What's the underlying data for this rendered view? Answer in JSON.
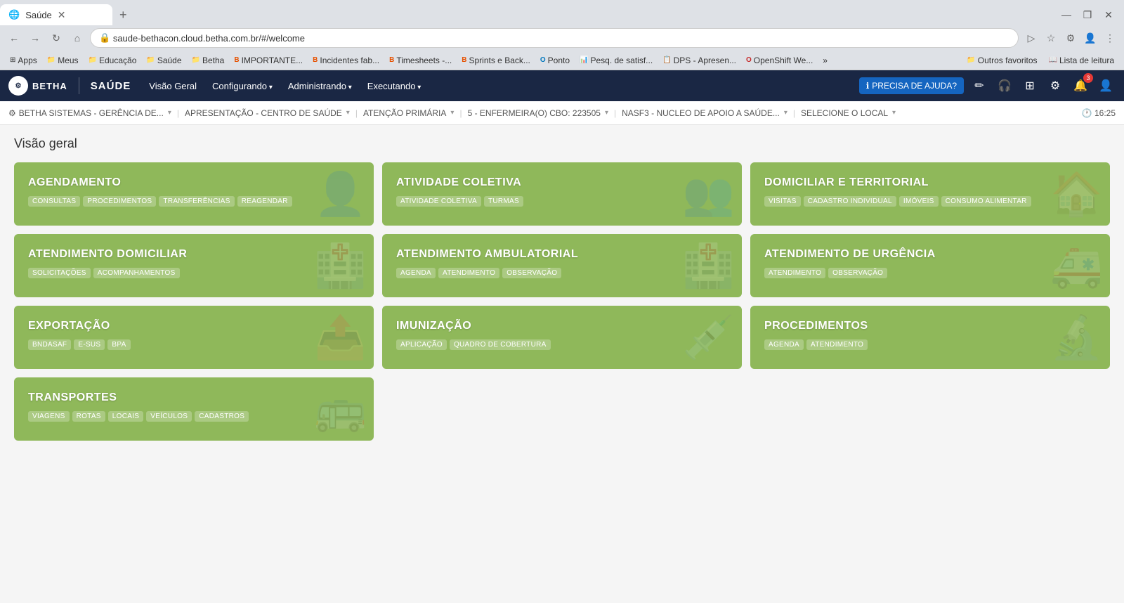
{
  "browser": {
    "tab_title": "Saúde",
    "url": "saude-bethacon.cloud.betha.com.br/#/welcome",
    "bookmarks": [
      {
        "label": "Apps",
        "icon": "⊞"
      },
      {
        "label": "Meus",
        "icon": "📁"
      },
      {
        "label": "Educação",
        "icon": "📁"
      },
      {
        "label": "Saúde",
        "icon": "📁"
      },
      {
        "label": "Betha",
        "icon": "📁"
      },
      {
        "label": "IMPORTANTE...",
        "icon": "B"
      },
      {
        "label": "Incidentes fab...",
        "icon": "B"
      },
      {
        "label": "Timesheets -...",
        "icon": "B"
      },
      {
        "label": "Sprints e Back...",
        "icon": "B"
      },
      {
        "label": "Ponto",
        "icon": "O"
      },
      {
        "label": "Pesq. de satisf...",
        "icon": "📊"
      },
      {
        "label": "DPS - Apresen...",
        "icon": "📋"
      },
      {
        "label": "OpenShift We...",
        "icon": "O"
      },
      {
        "label": "»",
        "icon": ""
      },
      {
        "label": "Outros favoritos",
        "icon": "📁"
      },
      {
        "label": "Lista de leitura",
        "icon": "📖"
      }
    ]
  },
  "header": {
    "logo_text": "BETHA",
    "system_name": "SAÚDE",
    "nav_items": [
      {
        "label": "Visão Geral",
        "dropdown": false
      },
      {
        "label": "Configurando",
        "dropdown": true
      },
      {
        "label": "Administrando",
        "dropdown": true
      },
      {
        "label": "Executando",
        "dropdown": true
      }
    ],
    "help_button": "PRECISA DE AJUDA?",
    "notification_count": "3"
  },
  "breadcrumbs": [
    {
      "label": "BETHA SISTEMAS - GERÊNCIA DE...",
      "has_chevron": true
    },
    {
      "label": "APRESENTAÇÃO - CENTRO DE SAÚDE",
      "has_chevron": true
    },
    {
      "label": "ATENÇÃO PRIMÁRIA",
      "has_chevron": true
    },
    {
      "label": "5 - ENFERMEIRA(O) CBO: 223505",
      "has_chevron": true
    },
    {
      "label": "NASF3 - NUCLEO DE APOIO A SAÚDE...",
      "has_chevron": true
    },
    {
      "label": "SELECIONE O LOCAL",
      "has_chevron": true
    }
  ],
  "time": "16:25",
  "page_title": "Visão geral",
  "cards": [
    {
      "title": "AGENDAMENTO",
      "tags": [
        "CONSULTAS",
        "PROCEDIMENTOS",
        "TRANSFERÊNCIAS",
        "REAGENDAR"
      ],
      "watermark": "👤"
    },
    {
      "title": "ATIVIDADE COLETIVA",
      "tags": [
        "ATIVIDADE COLETIVA",
        "TURMAS"
      ],
      "watermark": "👥"
    },
    {
      "title": "DOMICILIAR E TERRITORIAL",
      "tags": [
        "VISITAS",
        "CADASTRO INDIVIDUAL",
        "IMÓVEIS",
        "CONSUMO ALIMENTAR"
      ],
      "watermark": "🏠"
    },
    {
      "title": "ATENDIMENTO DOMICILIAR",
      "tags": [
        "SOLICITAÇÕES",
        "ACOMPANHAMENTOS"
      ],
      "watermark": "🏥"
    },
    {
      "title": "ATENDIMENTO AMBULATORIAL",
      "tags": [
        "AGENDA",
        "ATENDIMENTO",
        "OBSERVAÇÃO"
      ],
      "watermark": "🏥"
    },
    {
      "title": "ATENDIMENTO DE URGÊNCIA",
      "tags": [
        "ATENDIMENTO",
        "OBSERVAÇÃO"
      ],
      "watermark": "🚑"
    },
    {
      "title": "EXPORTAÇÃO",
      "tags": [
        "BNDASAF",
        "E-SUS",
        "BPA"
      ],
      "watermark": "📤"
    },
    {
      "title": "IMUNIZAÇÃO",
      "tags": [
        "APLICAÇÃO",
        "QUADRO DE COBERTURA"
      ],
      "watermark": "💉"
    },
    {
      "title": "PROCEDIMENTOS",
      "tags": [
        "AGENDA",
        "ATENDIMENTO"
      ],
      "watermark": "🔬"
    },
    {
      "title": "TRANSPORTES",
      "tags": [
        "VIAGENS",
        "ROTAS",
        "LOCAIS",
        "VEÍCULOS",
        "CADASTROS"
      ],
      "watermark": "🚌"
    }
  ]
}
